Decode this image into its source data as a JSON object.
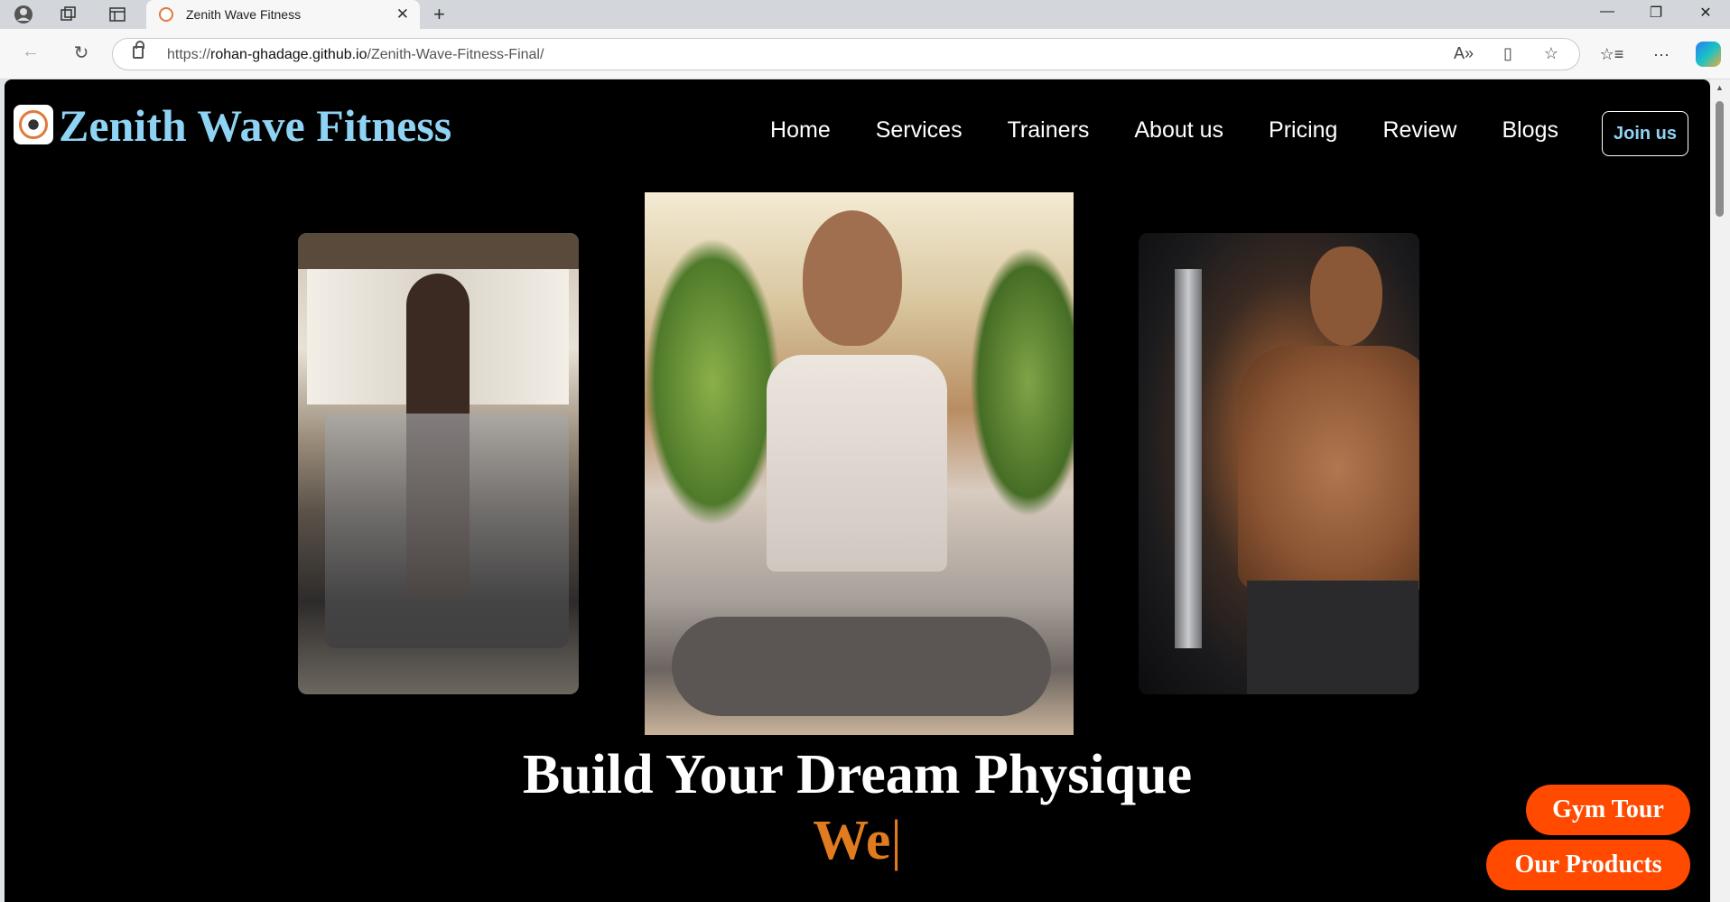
{
  "browser": {
    "tab_title": "Zenith Wave Fitness",
    "url_scheme": "https://",
    "url_host": "rohan-ghadage.github.io",
    "url_path": "/Zenith-Wave-Fitness-Final/",
    "icons": [
      "profile-icon",
      "workspaces-icon",
      "tab-actions-icon",
      "close-icon",
      "new-tab-icon",
      "back-icon",
      "reload-icon",
      "lock-icon",
      "read-aloud-icon",
      "immersive-reader-icon",
      "favorite-star-icon",
      "favorites-icon",
      "more-icon",
      "copilot-icon",
      "minimize-icon",
      "restore-icon",
      "window-close-icon"
    ]
  },
  "site": {
    "brand": "Zenith Wave Fitness",
    "nav": [
      "Home",
      "Services",
      "Trainers",
      "About us",
      "Pricing",
      "Review",
      "Blogs"
    ],
    "join_label": "Join us",
    "hero_title": "Build Your Dream Physique",
    "hero_typed": "We",
    "cursor": "|",
    "cta_tour": "Gym Tour",
    "cta_products": "Our Products",
    "colors": {
      "brand": "#8fd3f4",
      "accent": "#ff4a00",
      "typed": "#e07b20",
      "background": "#000000"
    }
  }
}
